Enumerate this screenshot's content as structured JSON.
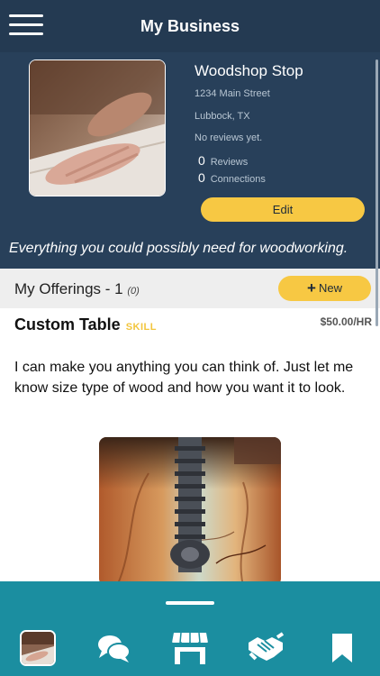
{
  "header": {
    "title": "My Business",
    "menu_icon": "hamburger-menu-icon"
  },
  "business": {
    "name": "Woodshop Stop",
    "address": "1234 Main Street",
    "city": "Lubbock, TX",
    "review_status": "No reviews yet.",
    "reviews_count": "0",
    "reviews_label": "Reviews",
    "connections_count": "0",
    "connections_label": "Connections",
    "edit_label": "Edit",
    "tagline": "Everything you could possibly need for woodworking."
  },
  "offerings": {
    "title": "My Offerings - 1",
    "count_note": "(0)",
    "new_label": "New",
    "items": [
      {
        "title": "Custom Table",
        "tag": "SKILL",
        "price": "$50.00/HR",
        "description": "I can make you anything you can think of. Just let me know size type of wood and how you want it to look."
      }
    ]
  },
  "tabbar": {
    "tabs": [
      "profile-avatar",
      "chat-icon",
      "store-icon",
      "handshake-icon",
      "bookmark-icon"
    ]
  },
  "colors": {
    "header_bg": "#243a52",
    "panel_bg": "#28405a",
    "accent_yellow": "#f7c843",
    "tabbar_bg": "#1b8ea0"
  }
}
